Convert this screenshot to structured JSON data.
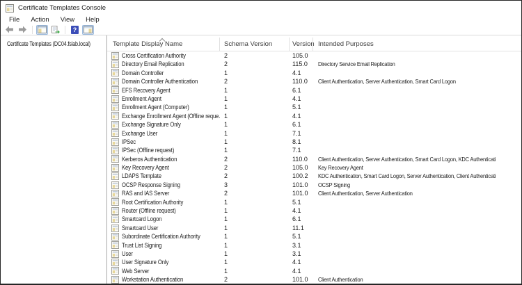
{
  "window": {
    "title": "Certificate Templates Console"
  },
  "menu": {
    "items": [
      {
        "label": "File"
      },
      {
        "label": "Action"
      },
      {
        "label": "View"
      },
      {
        "label": "Help"
      }
    ]
  },
  "toolbar": {
    "buttons": [
      "back-icon",
      "forward-icon",
      "show-console-tree-icon",
      "export-list-icon",
      "help-icon",
      "show-action-pane-icon"
    ]
  },
  "tree": {
    "root_label": "Certificate Templates (DC04.fslab.local)"
  },
  "table": {
    "columns": [
      "Template Display Name",
      "Schema Version",
      "Version",
      "Intended Purposes"
    ],
    "sort": {
      "column": "Template Display Name",
      "direction": "asc"
    },
    "rows": [
      {
        "name": "Cross Certification Authority",
        "schema": "2",
        "version": "105.0",
        "purposes": ""
      },
      {
        "name": "Directory Email Replication",
        "schema": "2",
        "version": "115.0",
        "purposes": "Directory Service Email Replication"
      },
      {
        "name": "Domain Controller",
        "schema": "1",
        "version": "4.1",
        "purposes": ""
      },
      {
        "name": "Domain Controller Authentication",
        "schema": "2",
        "version": "110.0",
        "purposes": "Client Authentication, Server Authentication, Smart Card Logon"
      },
      {
        "name": "EFS Recovery Agent",
        "schema": "1",
        "version": "6.1",
        "purposes": ""
      },
      {
        "name": "Enrollment Agent",
        "schema": "1",
        "version": "4.1",
        "purposes": ""
      },
      {
        "name": "Enrollment Agent (Computer)",
        "schema": "1",
        "version": "5.1",
        "purposes": ""
      },
      {
        "name": "Exchange Enrollment Agent (Offline reque...",
        "schema": "1",
        "version": "4.1",
        "purposes": ""
      },
      {
        "name": "Exchange Signature Only",
        "schema": "1",
        "version": "6.1",
        "purposes": ""
      },
      {
        "name": "Exchange User",
        "schema": "1",
        "version": "7.1",
        "purposes": ""
      },
      {
        "name": "IPSec",
        "schema": "1",
        "version": "8.1",
        "purposes": ""
      },
      {
        "name": "IPSec (Offline request)",
        "schema": "1",
        "version": "7.1",
        "purposes": ""
      },
      {
        "name": "Kerberos Authentication",
        "schema": "2",
        "version": "110.0",
        "purposes": "Client Authentication, Server Authentication, Smart Card Logon, KDC Authentication"
      },
      {
        "name": "Key Recovery Agent",
        "schema": "2",
        "version": "105.0",
        "purposes": "Key Recovery Agent"
      },
      {
        "name": "LDAPS Template",
        "schema": "2",
        "version": "100.2",
        "purposes": "KDC Authentication, Smart Card Logon, Server Authentication, Client Authentication"
      },
      {
        "name": "OCSP Response Signing",
        "schema": "3",
        "version": "101.0",
        "purposes": "OCSP Signing"
      },
      {
        "name": "RAS and IAS Server",
        "schema": "2",
        "version": "101.0",
        "purposes": "Client Authentication, Server Authentication"
      },
      {
        "name": "Root Certification Authority",
        "schema": "1",
        "version": "5.1",
        "purposes": ""
      },
      {
        "name": "Router (Offline request)",
        "schema": "1",
        "version": "4.1",
        "purposes": ""
      },
      {
        "name": "Smartcard Logon",
        "schema": "1",
        "version": "6.1",
        "purposes": ""
      },
      {
        "name": "Smartcard User",
        "schema": "1",
        "version": "11.1",
        "purposes": ""
      },
      {
        "name": "Subordinate Certification Authority",
        "schema": "1",
        "version": "5.1",
        "purposes": ""
      },
      {
        "name": "Trust List Signing",
        "schema": "1",
        "version": "3.1",
        "purposes": ""
      },
      {
        "name": "User",
        "schema": "1",
        "version": "3.1",
        "purposes": ""
      },
      {
        "name": "User Signature Only",
        "schema": "1",
        "version": "4.1",
        "purposes": ""
      },
      {
        "name": "Web Server",
        "schema": "1",
        "version": "4.1",
        "purposes": ""
      },
      {
        "name": "Workstation Authentication",
        "schema": "2",
        "version": "101.0",
        "purposes": "Client Authentication"
      }
    ]
  },
  "colors": {
    "window_border": "#262626",
    "toolbar_divider": "#d9d9d9",
    "pane_splitter": "#a8a8a8",
    "pressed_button_bg": "#e4eef9",
    "help_icon_blue": "#3b4db8",
    "export_arrow_green": "#3fae49"
  }
}
